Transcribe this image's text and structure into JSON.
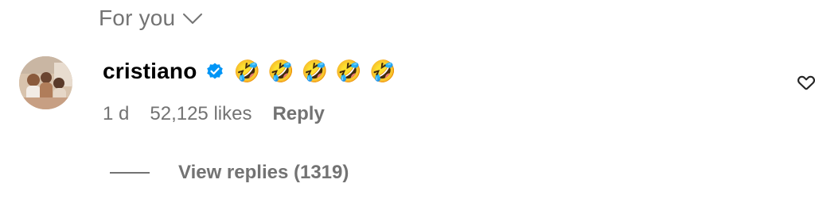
{
  "sort": {
    "label": "For you",
    "icon": "chevron-down-icon"
  },
  "comment": {
    "username": "cristiano",
    "verified_icon": "verified-badge-icon",
    "verified_color": "#0095f6",
    "text": "🤣🤣🤣🤣🤣",
    "time": "1 d",
    "likes": "52,125 likes",
    "reply_label": "Reply",
    "like_icon": "heart-icon"
  },
  "replies": {
    "label": "View replies (1319)"
  }
}
